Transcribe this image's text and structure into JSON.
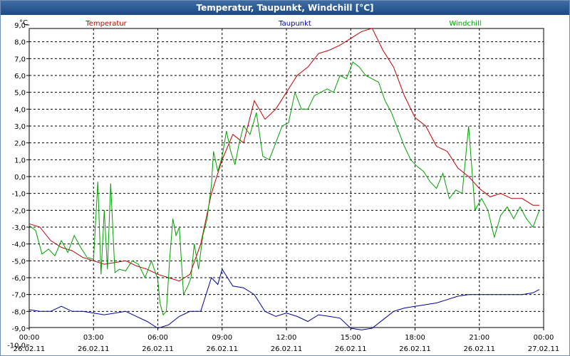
{
  "window": {
    "title": "Temperatur, Taupunkt, Windchill [°C]"
  },
  "colors": {
    "axis": "#000000",
    "grid": "#000000",
    "bg": "#ffffff"
  },
  "chart_data": {
    "type": "line",
    "title": "Temperatur, Taupunkt, Windchill [°C]",
    "ylabel": "°C",
    "ylim": [
      -10,
      9.5
    ],
    "y_ticks": [
      "9,0",
      "8,0",
      "7,0",
      "6,0",
      "5,0",
      "4,0",
      "3,0",
      "2,0",
      "1,0",
      "0,0",
      "-1,0",
      "-2,0",
      "-3,0",
      "-4,0",
      "-5,0",
      "-6,0",
      "-7,0",
      "-8,0",
      "-9,0",
      "-10,0"
    ],
    "y_tick_values": [
      9,
      8,
      7,
      6,
      5,
      4,
      3,
      2,
      1,
      0,
      -1,
      -2,
      -3,
      -4,
      -5,
      -6,
      -7,
      -8,
      -9,
      -10
    ],
    "x_ticks": [
      {
        "time": "00:00",
        "date": "26.02.11"
      },
      {
        "time": "03:00",
        "date": "26.02.11"
      },
      {
        "time": "06:00",
        "date": "26.02.11"
      },
      {
        "time": "09:00",
        "date": "26.02.11"
      },
      {
        "time": "12:00",
        "date": "26.02.11"
      },
      {
        "time": "15:00",
        "date": "26.02.11"
      },
      {
        "time": "18:00",
        "date": "26.02.11"
      },
      {
        "time": "21:00",
        "date": "26.02.11"
      },
      {
        "time": "00:00",
        "date": "27.02.11"
      }
    ],
    "x_tick_hours": [
      0,
      3,
      6,
      9,
      12,
      15,
      18,
      21,
      24
    ],
    "xlim_hours": [
      0,
      24
    ],
    "grid": true,
    "series": [
      {
        "name": "Temperatur",
        "color": "#c00000",
        "x": [
          0,
          0.5,
          1,
          1.5,
          2,
          2.5,
          3,
          3.5,
          4,
          4.5,
          5,
          5.5,
          6,
          6.5,
          7,
          7.5,
          8,
          8.5,
          9,
          9.5,
          10,
          10.5,
          11,
          11.5,
          12,
          12.5,
          13,
          13.5,
          14,
          14.5,
          15,
          15.5,
          16,
          16.5,
          17,
          17.5,
          18,
          18.5,
          19,
          19.5,
          20,
          20.5,
          21,
          21.5,
          22,
          22.5,
          23,
          23.5,
          23.8
        ],
        "y": [
          -2.8,
          -3.0,
          -3.8,
          -4.2,
          -4.4,
          -4.8,
          -5.0,
          -5.2,
          -5.1,
          -5.0,
          -5.3,
          -5.5,
          -5.8,
          -6.0,
          -6.2,
          -5.8,
          -4.0,
          -1.0,
          1.0,
          2.5,
          2.0,
          4.5,
          3.4,
          4.0,
          5.0,
          6.0,
          6.5,
          7.3,
          7.5,
          7.8,
          8.2,
          8.6,
          8.8,
          7.5,
          6.5,
          4.8,
          3.5,
          3.0,
          1.8,
          1.5,
          0.5,
          0.0,
          -0.7,
          -1.2,
          -1.0,
          -1.3,
          -1.3,
          -1.7,
          -1.7
        ]
      },
      {
        "name": "Taupunkt",
        "color": "#00009a",
        "x": [
          0,
          0.5,
          1,
          1.5,
          2,
          2.5,
          3,
          3.5,
          4,
          4.5,
          5,
          5.5,
          6,
          6.5,
          7,
          7.5,
          8,
          8.5,
          8.8,
          9,
          9.5,
          10,
          10.5,
          11,
          11.5,
          12,
          12.5,
          13,
          13.5,
          14,
          14.5,
          15,
          15.5,
          16,
          16.5,
          17,
          17.5,
          18,
          18.5,
          19,
          19.5,
          20,
          20.5,
          21,
          21.5,
          22,
          22.5,
          23,
          23.5,
          23.8
        ],
        "y": [
          -7.9,
          -8.0,
          -8.0,
          -7.7,
          -8.0,
          -8.0,
          -8.1,
          -8.2,
          -8.1,
          -8.0,
          -8.3,
          -8.6,
          -9.0,
          -8.8,
          -8.3,
          -8.0,
          -8.0,
          -6.0,
          -6.4,
          -5.5,
          -6.5,
          -6.6,
          -7.0,
          -8.0,
          -8.3,
          -8.1,
          -8.3,
          -8.6,
          -8.2,
          -8.3,
          -8.4,
          -9.0,
          -9.1,
          -9.0,
          -8.5,
          -8.0,
          -7.8,
          -7.7,
          -7.6,
          -7.5,
          -7.3,
          -7.1,
          -7.0,
          -7.0,
          -7.0,
          -7.0,
          -7.0,
          -7.0,
          -6.9,
          -6.7
        ]
      },
      {
        "name": "Windchill",
        "color": "#00a000",
        "x": [
          0,
          0.3,
          0.6,
          0.9,
          1.2,
          1.5,
          1.8,
          2.1,
          2.4,
          2.7,
          3.0,
          3.2,
          3.35,
          3.5,
          3.65,
          3.8,
          4.0,
          4.2,
          4.5,
          4.8,
          5.1,
          5.4,
          5.7,
          6.0,
          6.1,
          6.25,
          6.4,
          6.55,
          6.7,
          6.85,
          7.0,
          7.2,
          7.4,
          7.55,
          7.7,
          7.9,
          8.1,
          8.3,
          8.5,
          8.6,
          8.8,
          9.0,
          9.2,
          9.4,
          9.6,
          9.8,
          10.0,
          10.3,
          10.6,
          10.9,
          11.2,
          11.5,
          11.8,
          12.1,
          12.4,
          12.7,
          13.0,
          13.3,
          13.6,
          13.9,
          14.2,
          14.5,
          14.8,
          15.1,
          15.4,
          15.7,
          16.0,
          16.3,
          16.6,
          16.9,
          17.2,
          17.5,
          17.8,
          18.1,
          18.4,
          18.7,
          19.0,
          19.3,
          19.6,
          19.9,
          20.2,
          20.5,
          20.8,
          21.1,
          21.4,
          21.7,
          22.0,
          22.3,
          22.6,
          22.9,
          23.2,
          23.5,
          23.8
        ],
        "y": [
          -2.9,
          -3.2,
          -4.6,
          -4.3,
          -4.7,
          -3.8,
          -4.5,
          -3.5,
          -4.2,
          -4.8,
          -4.9,
          -0.3,
          -5.8,
          -2.0,
          -5.5,
          -0.4,
          -5.7,
          -5.5,
          -5.6,
          -5.0,
          -5.2,
          -6.0,
          -5.0,
          -6.1,
          -7.5,
          -8.2,
          -8.0,
          -5.0,
          -2.5,
          -3.5,
          -3.0,
          -7.0,
          -6.5,
          -6.0,
          -4.0,
          -5.5,
          -3.5,
          -2.5,
          -0.5,
          1.5,
          0.3,
          1.2,
          2.7,
          1.5,
          0.7,
          2.0,
          3.0,
          2.5,
          3.8,
          1.2,
          1.0,
          2.0,
          3.0,
          3.2,
          5.0,
          4.0,
          4.0,
          4.8,
          5.0,
          5.2,
          5.0,
          6.0,
          5.8,
          6.8,
          6.5,
          6.0,
          5.8,
          5.6,
          4.5,
          3.8,
          2.8,
          1.8,
          1.0,
          0.6,
          0.3,
          -0.3,
          -0.7,
          0.2,
          -1.3,
          -0.8,
          -1.0,
          3.0,
          -2.0,
          -1.3,
          -2.0,
          -3.6,
          -2.3,
          -1.8,
          -2.5,
          -1.8,
          -2.5,
          -3.0,
          -2.0
        ]
      }
    ]
  }
}
